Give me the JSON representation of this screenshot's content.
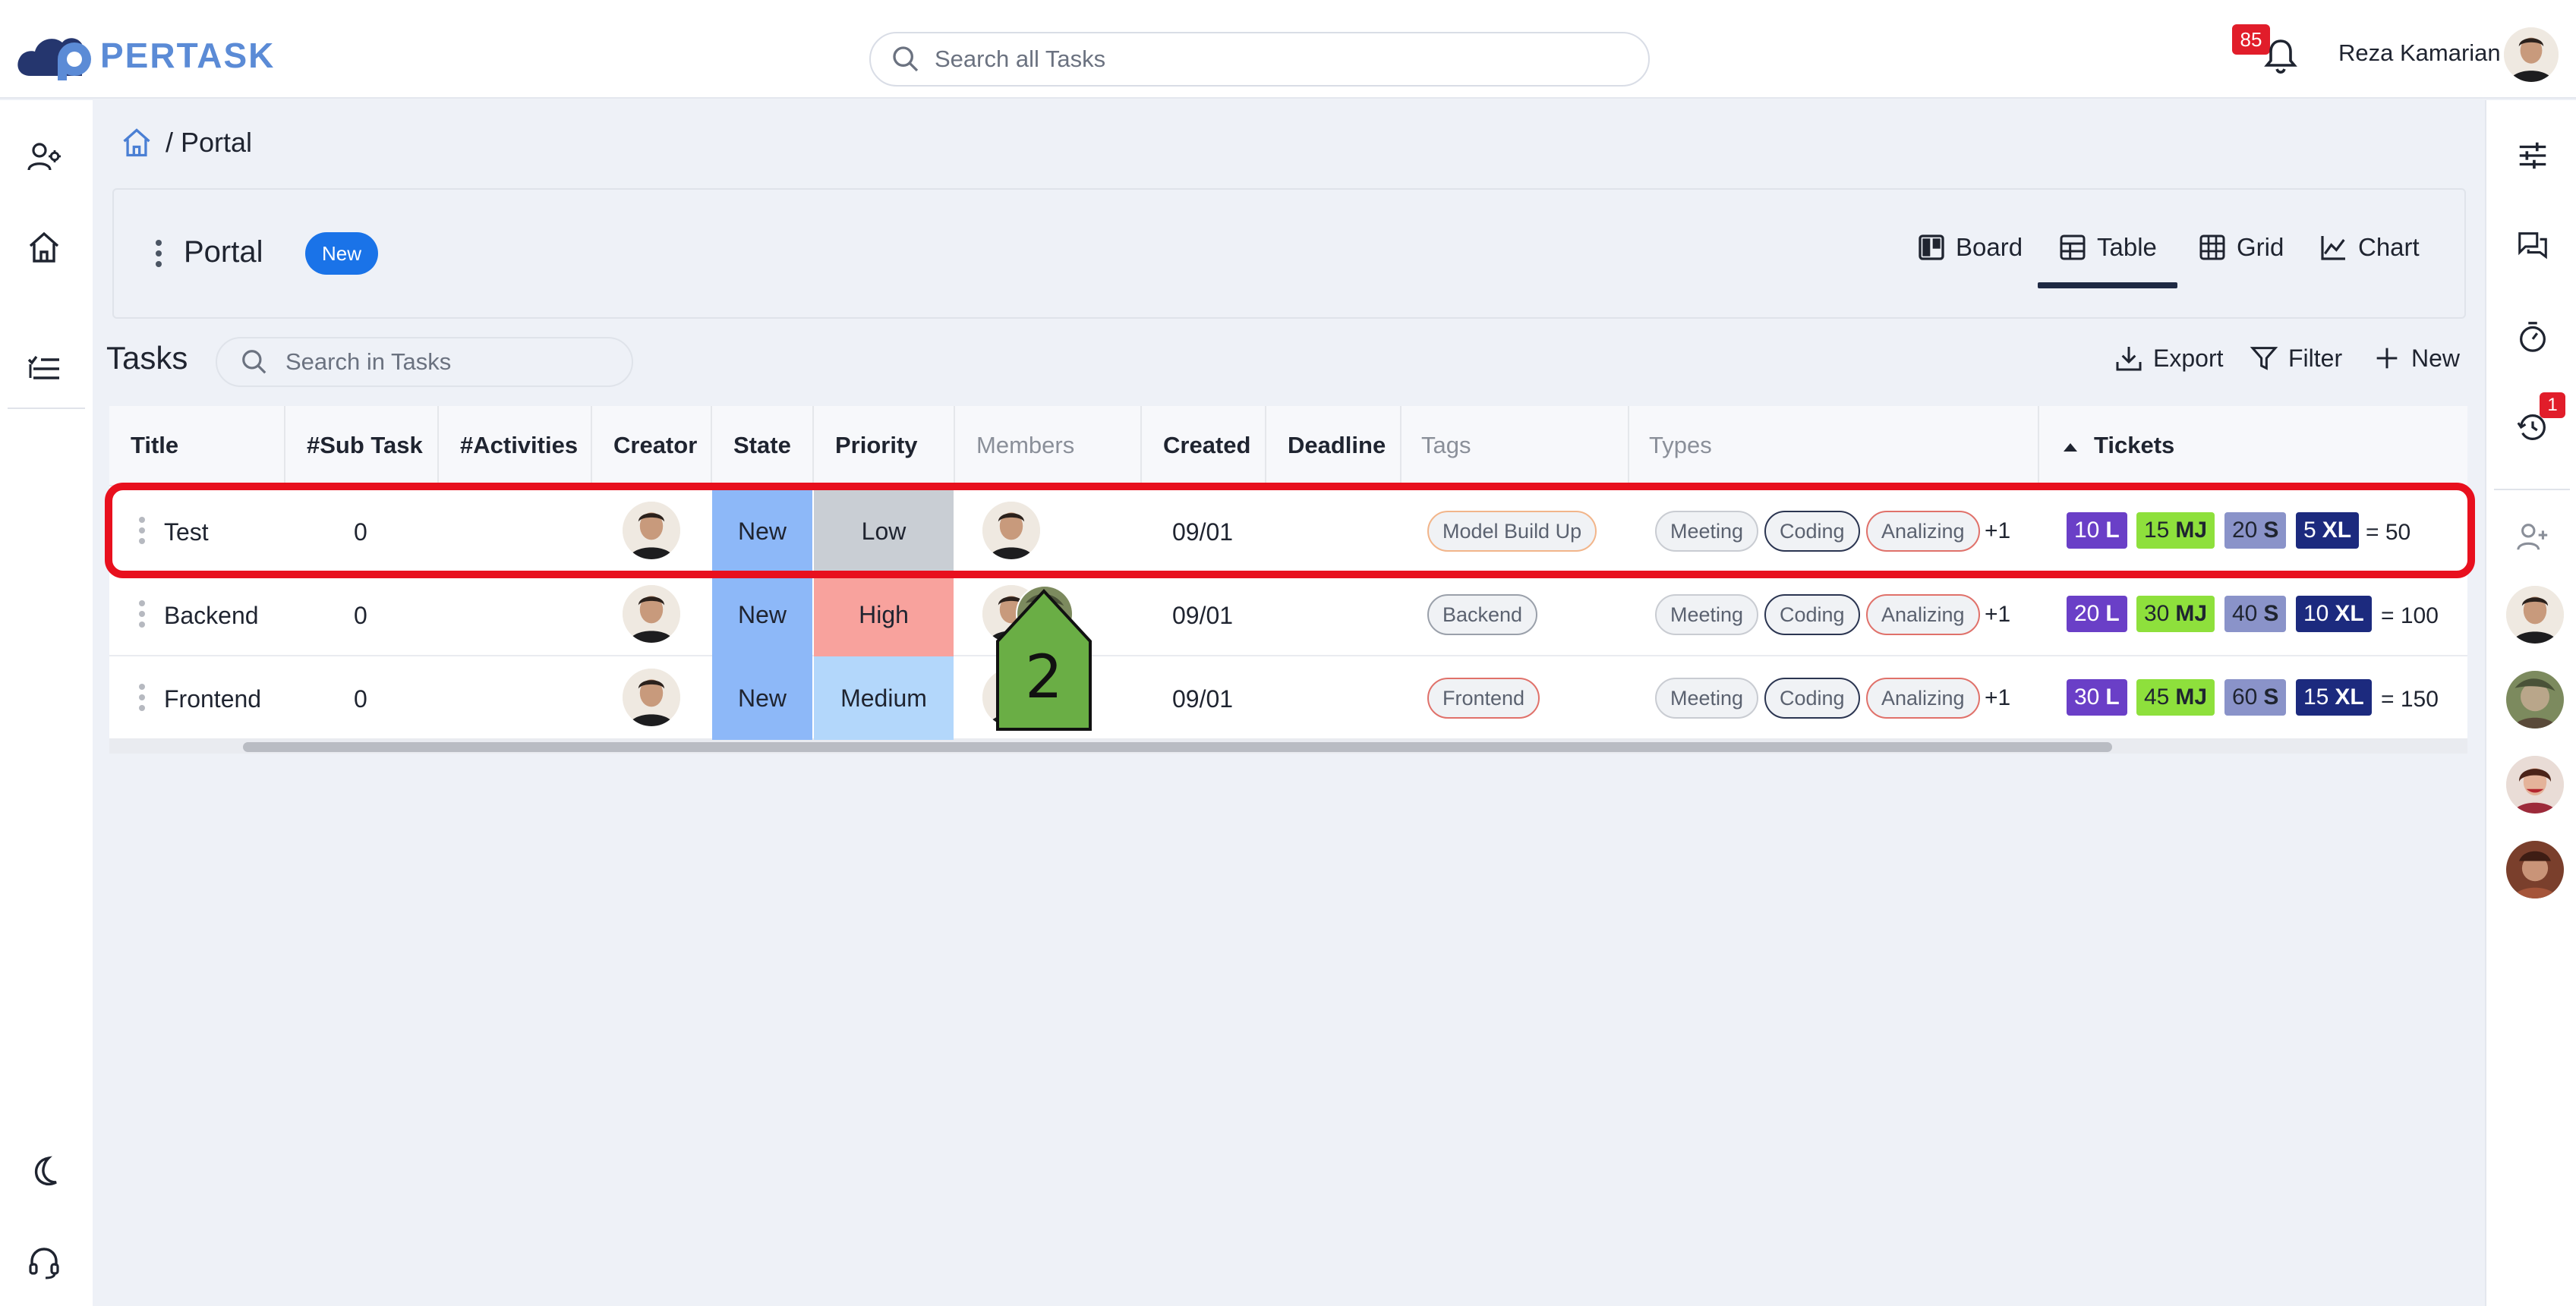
{
  "app": {
    "logo_text": "PERTASK"
  },
  "topbar": {
    "search_placeholder": "Search all Tasks",
    "notification_count": "85",
    "user_name": "Reza Kamarian"
  },
  "breadcrumb": {
    "separator": "/",
    "current": "Portal"
  },
  "portal": {
    "title": "Portal",
    "badge": "New",
    "views": [
      {
        "label": "Board",
        "icon": "board-icon"
      },
      {
        "label": "Table",
        "icon": "table-icon",
        "active": true
      },
      {
        "label": "Grid",
        "icon": "grid-icon"
      },
      {
        "label": "Chart",
        "icon": "chart-icon"
      }
    ]
  },
  "tasks": {
    "title": "Tasks",
    "search_placeholder": "Search in Tasks",
    "export_label": "Export",
    "filter_label": "Filter",
    "new_label": "New"
  },
  "table": {
    "columns": [
      "Title",
      "#Sub Task",
      "#Activities",
      "Creator",
      "State",
      "Priority",
      "Members",
      "Created",
      "Deadline",
      "Tags",
      "Types",
      "Tickets"
    ],
    "rows": [
      {
        "title": "Test",
        "sub_tasks": "0",
        "activities": "",
        "state": "New",
        "priority": "Low",
        "created": "09/01",
        "deadline": "",
        "tag": "Model Build Up",
        "types": [
          "Meeting",
          "Coding",
          "Analizing"
        ],
        "types_more": "+1",
        "tickets": [
          {
            "num": "10",
            "unit": "L"
          },
          {
            "num": "15",
            "unit": "MJ"
          },
          {
            "num": "20",
            "unit": "S"
          },
          {
            "num": "5",
            "unit": "XL"
          }
        ],
        "ticket_total": "= 50"
      },
      {
        "title": "Backend",
        "sub_tasks": "0",
        "activities": "",
        "state": "New",
        "priority": "High",
        "created": "09/01",
        "deadline": "",
        "tag": "Backend",
        "types": [
          "Meeting",
          "Coding",
          "Analizing"
        ],
        "types_more": "+1",
        "tickets": [
          {
            "num": "20",
            "unit": "L"
          },
          {
            "num": "30",
            "unit": "MJ"
          },
          {
            "num": "40",
            "unit": "S"
          },
          {
            "num": "10",
            "unit": "XL"
          }
        ],
        "ticket_total": "= 100"
      },
      {
        "title": "Frontend",
        "sub_tasks": "0",
        "activities": "",
        "state": "New",
        "priority": "Medium",
        "created": "09/01",
        "deadline": "",
        "tag": "Frontend",
        "types": [
          "Meeting",
          "Coding",
          "Analizing"
        ],
        "types_more": "+1",
        "tickets": [
          {
            "num": "30",
            "unit": "L"
          },
          {
            "num": "45",
            "unit": "MJ"
          },
          {
            "num": "60",
            "unit": "S"
          },
          {
            "num": "15",
            "unit": "XL"
          }
        ],
        "ticket_total": "= 150"
      }
    ]
  },
  "right_rail": {
    "history_badge": "1"
  },
  "annotation": {
    "step_number": "2"
  },
  "colors": {
    "state_new": "#8db8f8",
    "priority_low": "#c9ced4",
    "priority_high": "#f8a29d",
    "priority_medium": "#b3d7fb",
    "chip_L": "#6a3fc7",
    "chip_MJ": "#8ee03c",
    "chip_S": "#8a93c9",
    "chip_XL": "#1c2a7e",
    "highlight": "#e8101e",
    "marker": "#6aae45",
    "accent": "#1a73e8"
  }
}
